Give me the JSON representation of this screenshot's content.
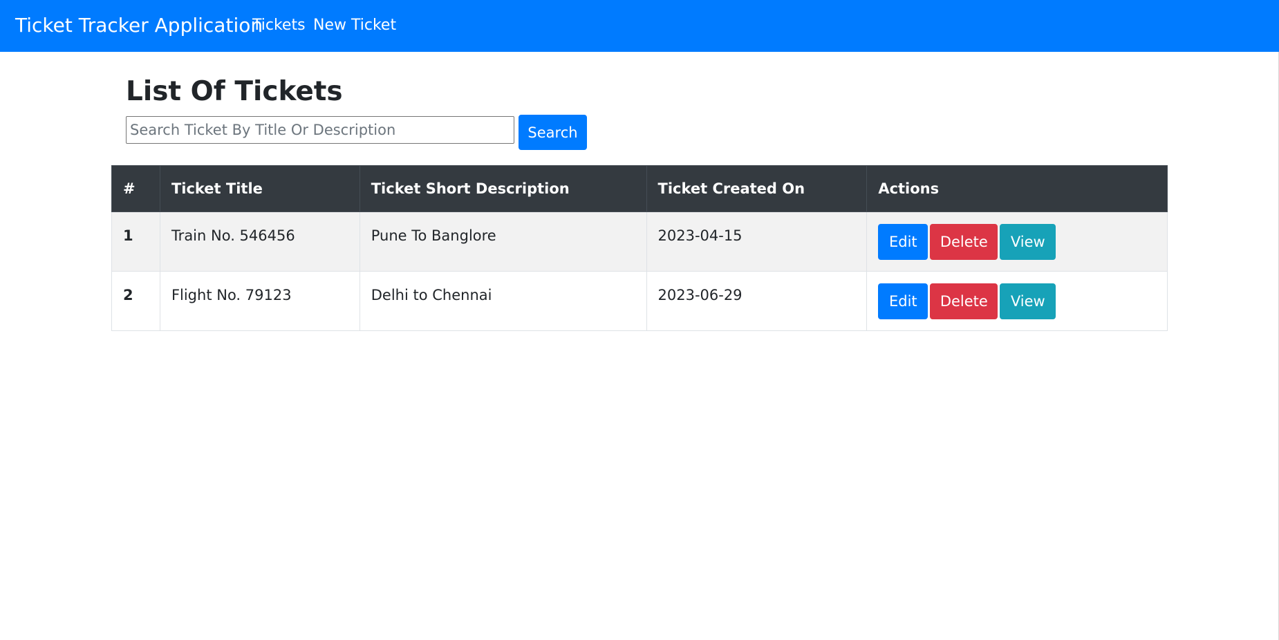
{
  "navbar": {
    "brand": "Ticket Tracker Application",
    "links": [
      {
        "label": "Tickets"
      },
      {
        "label": "New Ticket"
      }
    ],
    "background": "#007bff"
  },
  "main": {
    "title": "List Of Tickets",
    "search": {
      "placeholder": "Search Ticket By Title Or Description",
      "value": "",
      "button_label": "Search"
    },
    "table": {
      "headers": [
        "#",
        "Ticket Title",
        "Ticket Short Description",
        "Ticket Created On",
        "Actions"
      ],
      "rows": [
        {
          "num": "1",
          "title": "Train No. 546456",
          "description": "Pune To Banglore",
          "created_on": "2023-04-15",
          "actions": {
            "edit": "Edit",
            "delete": "Delete",
            "view": "View"
          }
        },
        {
          "num": "2",
          "title": "Flight No. 79123",
          "description": "Delhi to Chennai",
          "created_on": "2023-06-29",
          "actions": {
            "edit": "Edit",
            "delete": "Delete",
            "view": "View"
          }
        }
      ]
    }
  },
  "colors": {
    "primary": "#007bff",
    "danger": "#dc3545",
    "info": "#17a2b8",
    "table_header": "#343a40"
  }
}
